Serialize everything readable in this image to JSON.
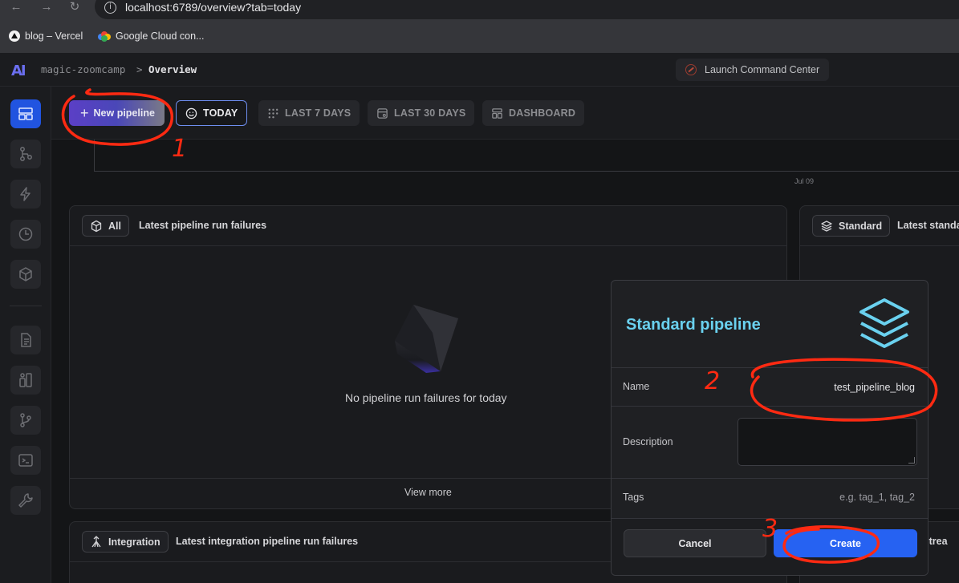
{
  "browser": {
    "url": "localhost:6789/overview?tab=today",
    "bookmarks": [
      {
        "label": "blog – Vercel"
      },
      {
        "label": "Google Cloud con..."
      }
    ]
  },
  "header": {
    "logo": "AI",
    "project": "magic-zoomcamp",
    "separator": ">",
    "page": "Overview",
    "launch_button": "Launch Command Center"
  },
  "toolbar": {
    "new_pipeline": "New pipeline",
    "tabs": [
      {
        "label": "TODAY",
        "active": true
      },
      {
        "label": "LAST 7 DAYS",
        "active": false
      },
      {
        "label": "LAST 30 DAYS",
        "active": false
      },
      {
        "label": "DASHBOARD",
        "active": false
      }
    ]
  },
  "chart": {
    "x_label": "Jul 09"
  },
  "panels": {
    "all": {
      "chip": "All",
      "title": "Latest pipeline run failures",
      "empty": "No pipeline run failures for today",
      "view_more": "View more"
    },
    "standard": {
      "chip": "Standard",
      "title": "Latest standa"
    },
    "integration": {
      "chip": "Integration",
      "title": "Latest integration pipeline run failures"
    },
    "streaming": {
      "title_fragment": "t strea"
    }
  },
  "modal": {
    "title": "Standard pipeline",
    "name_label": "Name",
    "name_value": "test_pipeline_blog",
    "description_label": "Description",
    "description_value": "",
    "tags_label": "Tags",
    "tags_placeholder": "e.g. tag_1, tag_2",
    "cancel": "Cancel",
    "create": "Create"
  },
  "annotations": [
    "1",
    "2",
    "3"
  ],
  "colors": {
    "accent_blue": "#2662f2",
    "modal_title": "#6ad1ef",
    "annotation_red": "#ff2a12"
  }
}
